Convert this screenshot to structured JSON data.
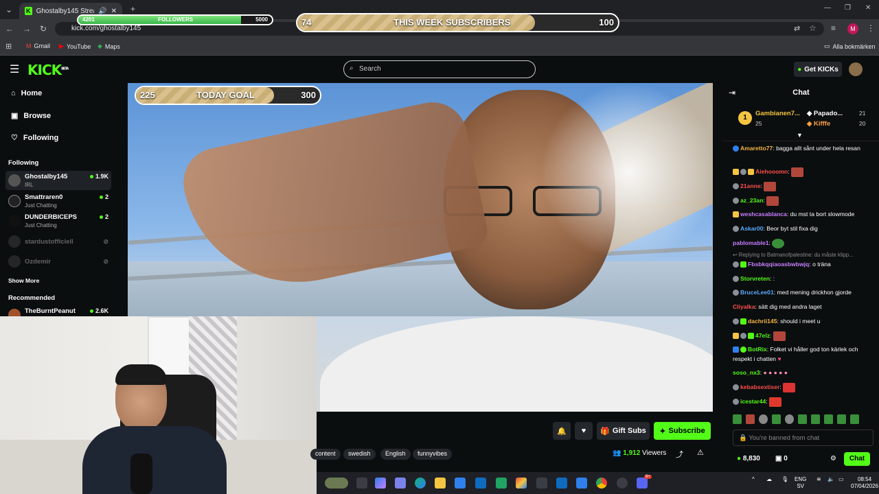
{
  "browser": {
    "tab_title": "Ghostalby145 Stream - Wat",
    "url": "kick.com/ghostalby145",
    "bookmarks": [
      {
        "label": "Gmail",
        "icon": "gmail-icon"
      },
      {
        "label": "YouTube",
        "icon": "youtube-icon"
      },
      {
        "label": "Maps",
        "icon": "maps-icon"
      }
    ],
    "all_bookmarks": "Alla bokmärken",
    "profile_initial": "M"
  },
  "overlays": {
    "followers": {
      "current": "4201",
      "label": "FOLLOWERS",
      "target": "5000",
      "progress": 0.84
    },
    "week_subs": {
      "current": "74",
      "label": "THIS WEEK SUBSCRIBERS",
      "target": "100",
      "progress": 0.74
    },
    "today_goal": {
      "current": "225",
      "label": "TODAY GOAL",
      "target": "300",
      "progress": 0.75
    }
  },
  "header": {
    "logo": "KICK",
    "logo_beta": "BETA",
    "search_placeholder": "Search",
    "get_kicks": "Get KICKs"
  },
  "sidebar": {
    "nav": [
      {
        "label": "Home",
        "icon": "home-icon"
      },
      {
        "label": "Browse",
        "icon": "browse-icon"
      },
      {
        "label": "Following",
        "icon": "heart-icon"
      }
    ],
    "following_title": "Following",
    "following": [
      {
        "name": "Ghostalby145",
        "category": "IRL",
        "viewers": "1.9K",
        "live": true
      },
      {
        "name": "Smattraren0",
        "category": "Just Chatting",
        "viewers": "2",
        "live": true
      },
      {
        "name": "DUNDERBICEPS",
        "category": "Just Chatting",
        "viewers": "2",
        "live": true
      },
      {
        "name": "stardustofficiell",
        "category": "",
        "viewers": "",
        "live": false
      },
      {
        "name": "Ozdemir",
        "category": "",
        "viewers": "",
        "live": false
      }
    ],
    "show_more": "Show More",
    "recommended_title": "Recommended",
    "recommended": [
      {
        "name": "TheBurntPeanut",
        "viewers": "2.6K"
      }
    ]
  },
  "stream": {
    "gift_subs": "Gift Subs",
    "subscribe": "Subscribe",
    "tags": [
      "content",
      "swedish",
      "English",
      "funnyvibes"
    ],
    "viewers": "1,912",
    "viewers_label": "Viewers"
  },
  "chat": {
    "title": "Chat",
    "leaderboard": [
      {
        "rank": "1",
        "name": "Gambianen7...",
        "count": "25"
      },
      {
        "name": "Papado...",
        "count": "21"
      },
      {
        "name": "Kifffe",
        "count": "20"
      }
    ],
    "messages": [
      {
        "user": "Amaretto77",
        "color": "#f5b642",
        "text": "bagga allt sånt under hela resan"
      },
      {
        "user": "Aiehooomn",
        "color": "#ff4d4d",
        "text": ""
      },
      {
        "user": "21anne",
        "color": "#ff4d4d",
        "text": ""
      },
      {
        "user": "az_23an",
        "color": "#53fc18",
        "text": ""
      },
      {
        "user": "weshcasablanca",
        "color": "#c77dff",
        "text": "du mst ta bort slowmode"
      },
      {
        "user": "Askar00",
        "color": "#5aa9ff",
        "text": "Beor byt stil fixa dig"
      },
      {
        "user": "pablomable1",
        "color": "#c77dff",
        "text": ""
      },
      {
        "reply": "Replying to Batmanofpalestine: du måste klipp..."
      },
      {
        "user": "Fbsbkqqiaoasbwbwjq",
        "color": "#c77dff",
        "text": "o träna"
      },
      {
        "user": "Storvreten",
        "color": "#53fc18",
        "text": ":"
      },
      {
        "user": "BruceLee01",
        "color": "#5aa9ff",
        "text": "med mening drickhon gjorde"
      },
      {
        "user": "Cliyalka",
        "color": "#ff4d4d",
        "text": "sätt dig med andra laget"
      },
      {
        "user": "dachrii145",
        "color": "#f5b642",
        "text": "should i meet u"
      },
      {
        "user": "47elz",
        "color": "#53fc18",
        "text": ""
      },
      {
        "user": "BotRix",
        "color": "#53fc18",
        "text": "Folket vi håller god ton kärlek och respekt i chatten"
      },
      {
        "user": "soso_nx3",
        "color": "#53fc18",
        "text": ""
      },
      {
        "user": "kebabsextiser",
        "color": "#ff4d4d",
        "text": ""
      },
      {
        "user": "icestar44",
        "color": "#53fc18",
        "text": ""
      }
    ],
    "input_placeholder": "You're banned from chat",
    "kicks_balance": "8,830",
    "chest_count": "0",
    "send_label": "Chat"
  },
  "taskbar": {
    "lang_top": "ENG",
    "lang_bottom": "SV",
    "time": "08:54",
    "date": "07/04/2026",
    "notif_badge": "9+"
  },
  "colors": {
    "kick_green": "#53fc18",
    "bg": "#0b0e0f",
    "surface": "#24272c"
  }
}
